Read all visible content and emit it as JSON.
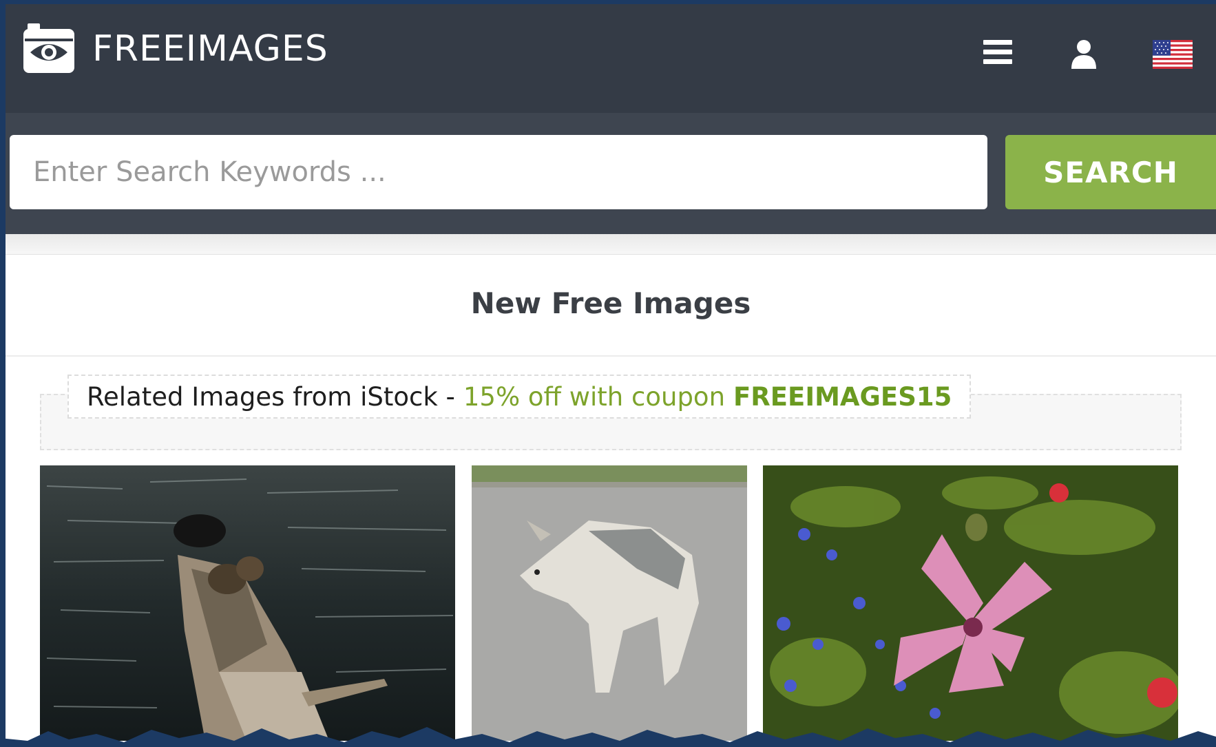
{
  "header": {
    "brand": "FREEIMAGES",
    "icons": [
      "camera-eye-logo",
      "hamburger-menu-icon",
      "user-icon",
      "us-flag-icon"
    ]
  },
  "search": {
    "placeholder": "Enter Search Keywords ...",
    "value": "",
    "button_label": "SEARCH"
  },
  "main": {
    "section_title": "New Free Images",
    "istock": {
      "label": "Related Images from iStock -",
      "promo": "15% off with coupon",
      "coupon_code": "FREEIMAGES15"
    },
    "thumbnails": [
      {
        "subject": "ducks-on-log-in-water"
      },
      {
        "subject": "grey-wolf-on-road"
      },
      {
        "subject": "pink-mallow-flower"
      }
    ]
  },
  "colors": {
    "header_bg": "#343b46",
    "search_band_bg": "#3e4550",
    "search_button": "#8bb34a",
    "promo_green": "#7da32b",
    "border_blue": "#1c3a63"
  }
}
